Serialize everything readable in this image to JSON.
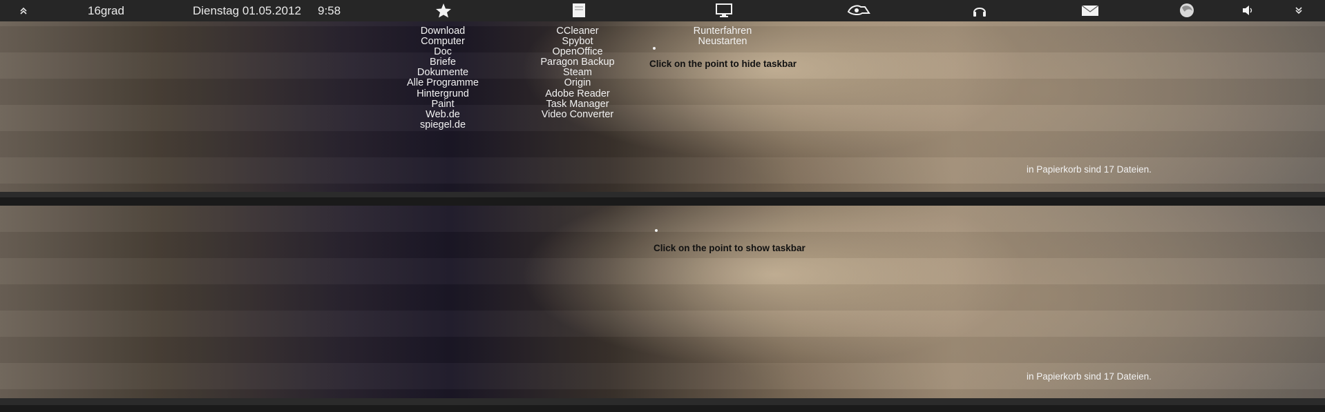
{
  "taskbar": {
    "collapse_icon": "double-chevron-up-icon",
    "weather": "16grad",
    "date": "Dienstag 01.05.2012",
    "time": "9:58",
    "icons": [
      "star-icon",
      "document-icon",
      "monitor-icon",
      "deviantart-icon",
      "headphones-icon",
      "mail-icon",
      "firefox-icon",
      "speaker-icon",
      "double-chevron-down-icon"
    ]
  },
  "menus": {
    "column1": [
      "Download",
      "Computer",
      "Doc",
      "Briefe",
      "Dokumente",
      "Alle Programme",
      "Hintergrund",
      "Paint",
      "Web.de",
      "spiegel.de"
    ],
    "column2": [
      "CCleaner",
      "Spybot",
      "OpenOffice",
      "Paragon Backup",
      "Steam",
      "Origin",
      "Adobe Reader",
      "Task Manager",
      "Video Converter"
    ],
    "column3": [
      "Runterfahren",
      "Neustarten"
    ]
  },
  "top_panel": {
    "hint": "Click on the point to hide taskbar",
    "trash": "in Papierkorb sind 17 Dateien."
  },
  "bottom_panel": {
    "hint": "Click on the point to show taskbar",
    "trash": "in Papierkorb sind 17 Dateien."
  }
}
